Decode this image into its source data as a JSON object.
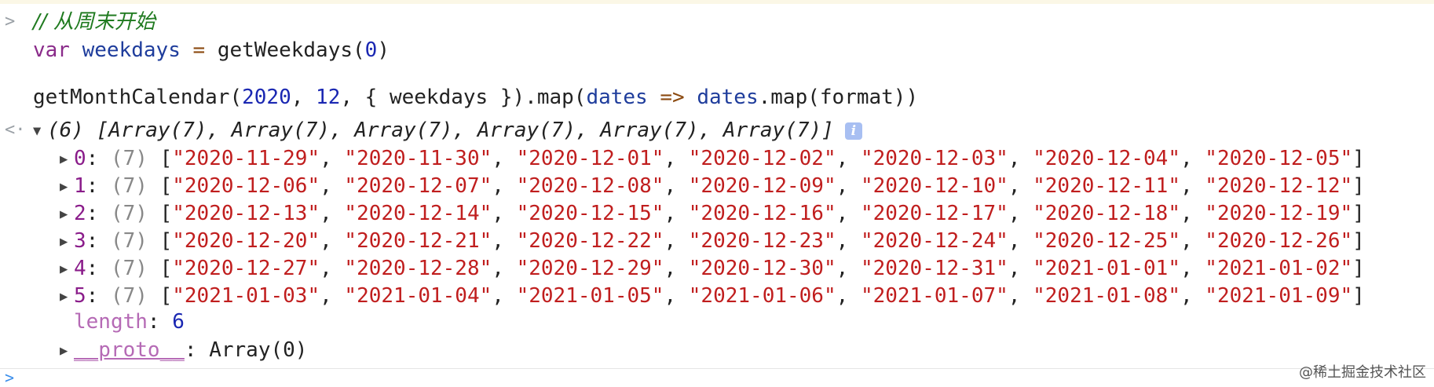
{
  "console": {
    "input_prompt": ">",
    "output_prompt": "<·",
    "code": {
      "comment": "// 从周末开始",
      "line2": {
        "keyword": "var",
        "name": "weekdays",
        "assign": "=",
        "call": "getWeekdays(",
        "arg": "0",
        "close": ")"
      },
      "line4": {
        "fn": "getMonthCalendar(",
        "year": "2020",
        "comma1": ", ",
        "month": "12",
        "obj": ", { weekdays }).map(",
        "param": "dates",
        "arrow": "=>",
        "target": "dates",
        "rest": ".map(format))"
      }
    },
    "result": {
      "summary": "(6) [Array(7), Array(7), Array(7), Array(7), Array(7), Array(7)]",
      "info_icon": "i",
      "rows": [
        {
          "index": "0",
          "count": "(7)",
          "values": [
            "2020-11-29",
            "2020-11-30",
            "2020-12-01",
            "2020-12-02",
            "2020-12-03",
            "2020-12-04",
            "2020-12-05"
          ]
        },
        {
          "index": "1",
          "count": "(7)",
          "values": [
            "2020-12-06",
            "2020-12-07",
            "2020-12-08",
            "2020-12-09",
            "2020-12-10",
            "2020-12-11",
            "2020-12-12"
          ]
        },
        {
          "index": "2",
          "count": "(7)",
          "values": [
            "2020-12-13",
            "2020-12-14",
            "2020-12-15",
            "2020-12-16",
            "2020-12-17",
            "2020-12-18",
            "2020-12-19"
          ]
        },
        {
          "index": "3",
          "count": "(7)",
          "values": [
            "2020-12-20",
            "2020-12-21",
            "2020-12-22",
            "2020-12-23",
            "2020-12-24",
            "2020-12-25",
            "2020-12-26"
          ]
        },
        {
          "index": "4",
          "count": "(7)",
          "values": [
            "2020-12-27",
            "2020-12-28",
            "2020-12-29",
            "2020-12-30",
            "2020-12-31",
            "2021-01-01",
            "2021-01-02"
          ]
        },
        {
          "index": "5",
          "count": "(7)",
          "values": [
            "2021-01-03",
            "2021-01-04",
            "2021-01-05",
            "2021-01-06",
            "2021-01-07",
            "2021-01-08",
            "2021-01-09"
          ]
        }
      ],
      "length_label": "length",
      "length_value": "6",
      "proto_label": "__proto__",
      "proto_value": "Array(0)"
    },
    "next_prompt": ">"
  },
  "watermark": "@稀土掘金技术社区",
  "colors": {
    "string": "#c01e1e",
    "number": "#1a27b2",
    "keyword": "#8a2b8a",
    "comment": "#1f7a1f"
  }
}
